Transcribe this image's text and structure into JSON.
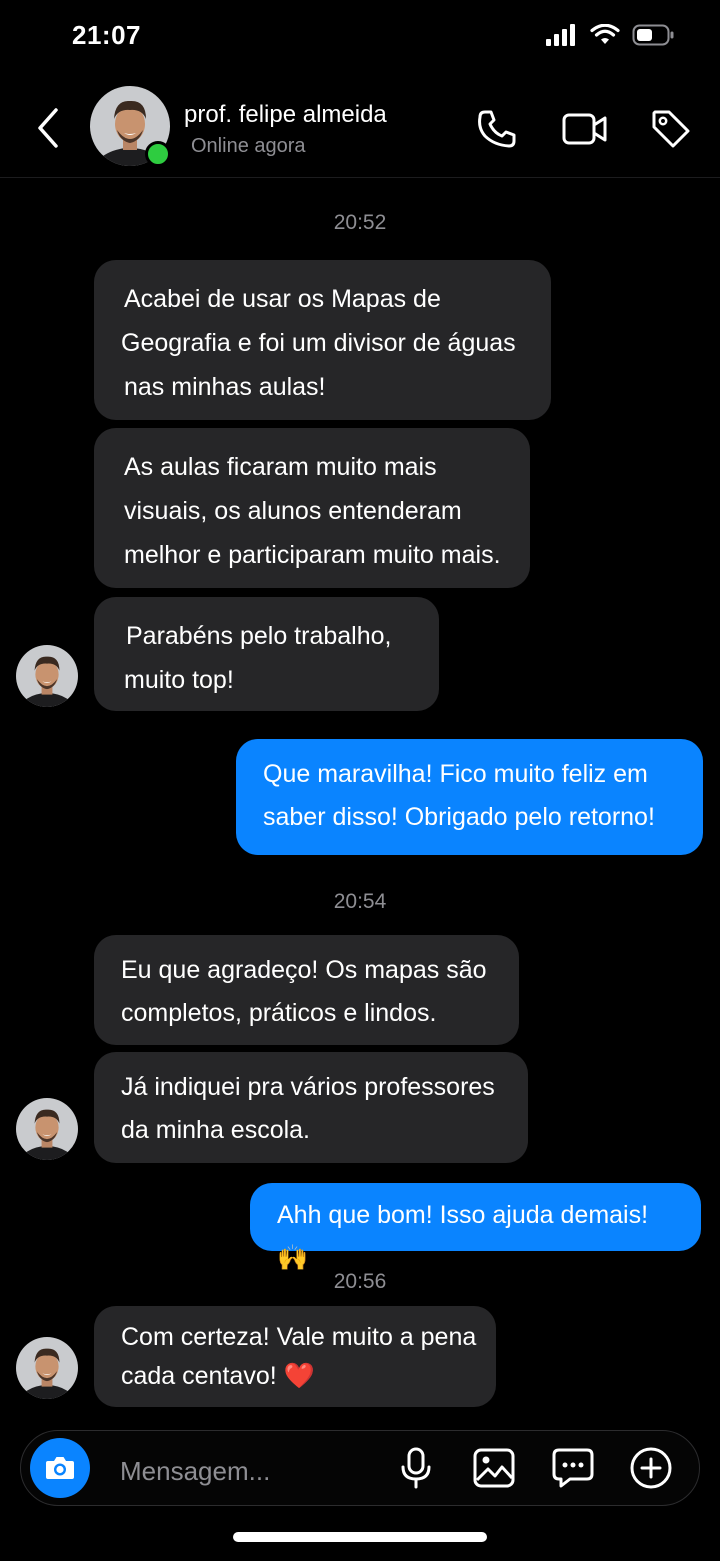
{
  "status_bar": {
    "time": "21:07"
  },
  "header": {
    "contact_name": "prof. felipe almeida",
    "contact_status": "Online agora"
  },
  "chat": {
    "timestamps": [
      "20:52",
      "20:54",
      "20:56"
    ],
    "messages": [
      {
        "dir": "in",
        "lines": [
          "Acabei de usar os Mapas de",
          "Geografia e foi um divisor de águas",
          "nas minhas aulas!"
        ]
      },
      {
        "dir": "in",
        "lines": [
          "As aulas ficaram muito mais",
          "visuais, os alunos entenderam",
          "melhor e participaram muito mais."
        ]
      },
      {
        "dir": "in",
        "lines": [
          "Parabéns pelo trabalho,",
          "muito top!"
        ]
      },
      {
        "dir": "out",
        "lines": [
          "Que maravilha! Fico muito feliz em",
          "saber disso! Obrigado pelo retorno!"
        ]
      },
      {
        "dir": "in",
        "lines": [
          "Eu que agradeço! Os mapas são",
          "completos, práticos e lindos."
        ]
      },
      {
        "dir": "in",
        "lines": [
          "Já indiquei pra vários professores",
          "da minha escola."
        ]
      },
      {
        "dir": "out",
        "lines": [
          "Ahh que bom! Isso ajuda demais! 🙌"
        ]
      },
      {
        "dir": "in",
        "lines": [
          "Com certeza! Vale muito a pena",
          "cada centavo! ❤️"
        ]
      }
    ]
  },
  "composer": {
    "placeholder": "Mensagem..."
  },
  "icons": [
    "back-chevron-icon",
    "phone-icon",
    "video-call-icon",
    "tag-icon",
    "camera-icon",
    "microphone-icon",
    "gallery-icon",
    "chat-bubble-icon",
    "plus-circle-icon",
    "signal-icon",
    "wifi-icon",
    "battery-icon"
  ],
  "colors": {
    "accent": "#0a84ff",
    "incoming_bubble": "#262628",
    "online": "#2ecc40",
    "background": "#000000"
  }
}
